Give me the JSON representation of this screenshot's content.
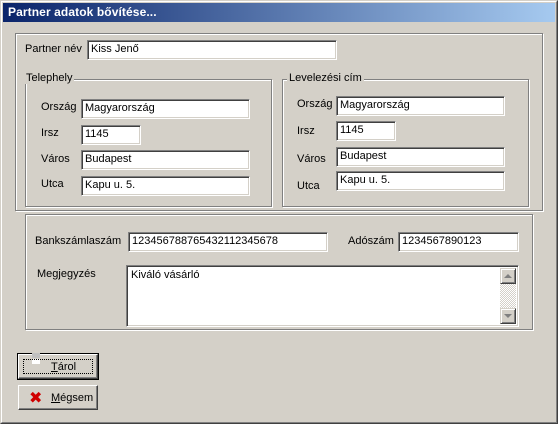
{
  "window": {
    "title": "Partner adatok bővítése..."
  },
  "partner": {
    "name_label": "Partner név",
    "name_value": "Kiss Jenő"
  },
  "telephely": {
    "group_label": "Telephely",
    "orszag_label": "Ország",
    "orszag_value": "Magyarország",
    "irsz_label": "Irsz",
    "irsz_value": "1145",
    "varos_label": "Város",
    "varos_value": "Budapest",
    "utca_label": "Utca",
    "utca_value": "Kapu u. 5."
  },
  "levelezesi": {
    "group_label": "Levelezési cím",
    "orszag_label": "Ország",
    "orszag_value": "Magyarország",
    "irsz_label": "Irsz",
    "irsz_value": "1145",
    "varos_label": "Város",
    "varos_value": "Budapest",
    "utca_label": "Utca",
    "utca_value": "Kapu u. 5."
  },
  "bank": {
    "bankszamla_label": "Bankszámlaszám",
    "bankszamla_value": "123456788765432112345678",
    "adoszam_label": "Adószám",
    "adoszam_value": "1234567890123",
    "megjegyzes_label": "Megjegyzés",
    "megjegyzes_value": "Kiváló vásárló"
  },
  "buttons": {
    "tarol_accel": "T",
    "tarol_rest": "árol",
    "megsem_accel": "M",
    "megsem_rest": "égsem"
  },
  "icons": {
    "tarol": "floppy-disk-icon",
    "megsem": "red-x-icon"
  }
}
